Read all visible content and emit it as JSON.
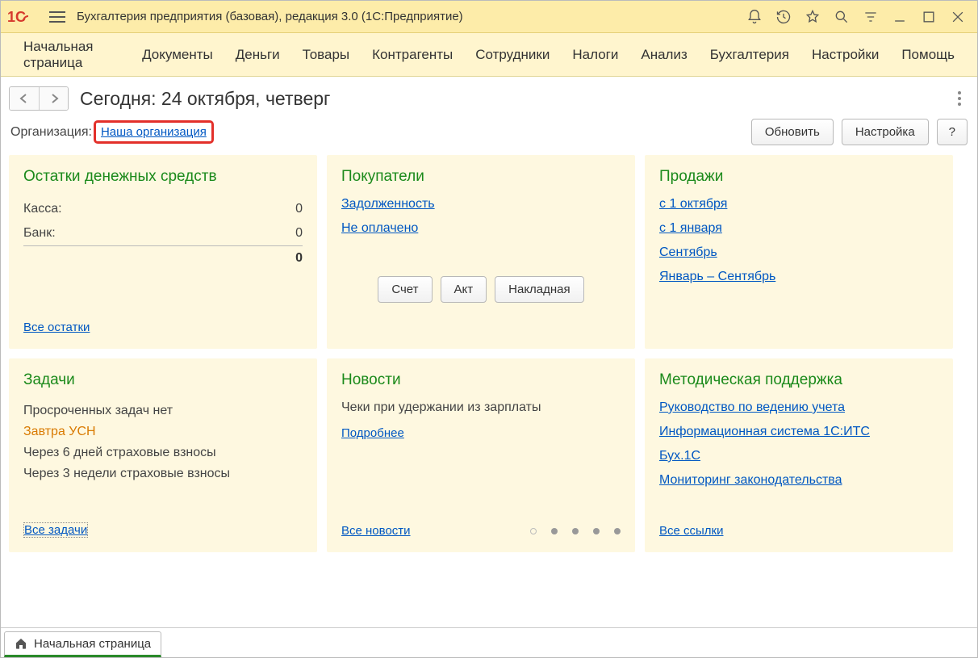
{
  "titlebar": {
    "title": "Бухгалтерия предприятия (базовая), редакция 3.0  (1С:Предприятие)"
  },
  "menu": {
    "items": [
      "Начальная страница",
      "Документы",
      "Деньги",
      "Товары",
      "Контрагенты",
      "Сотрудники",
      "Налоги",
      "Анализ",
      "Бухгалтерия",
      "Настройки",
      "Помощь"
    ]
  },
  "page": {
    "title": "Сегодня: 24 октября, четверг",
    "org_label": "Организация:",
    "org_link": "Наша организация",
    "refresh_btn": "Обновить",
    "settings_btn": "Настройка",
    "help_btn": "?"
  },
  "widgets": {
    "cash": {
      "title": "Остатки денежных средств",
      "rows": [
        {
          "label": "Касса:",
          "value": "0"
        },
        {
          "label": "Банк:",
          "value": "0"
        }
      ],
      "total": "0",
      "footer_link": "Все остатки"
    },
    "buyers": {
      "title": "Покупатели",
      "links": [
        "Задолженность",
        "Не оплачено"
      ],
      "buttons": [
        "Счет",
        "Акт",
        "Накладная"
      ]
    },
    "sales": {
      "title": "Продажи",
      "links": [
        "с 1 октября",
        "с 1 января",
        "Сентябрь",
        "Январь – Сентябрь"
      ]
    },
    "tasks": {
      "title": "Задачи",
      "items": [
        {
          "text": "Просроченных задач нет",
          "style": "normal"
        },
        {
          "text": "Завтра УСН",
          "style": "orange"
        },
        {
          "text": "Через 6 дней страховые взносы",
          "style": "normal"
        },
        {
          "text": "Через 3 недели страховые взносы",
          "style": "normal"
        }
      ],
      "footer_link": "Все задачи"
    },
    "news": {
      "title": "Новости",
      "headline": "Чеки при удержании из зарплаты",
      "more_link": "Подробнее",
      "footer_link": "Все новости",
      "page_count": 5,
      "active_page": 1
    },
    "support": {
      "title": "Методическая поддержка",
      "links": [
        "Руководство по ведению учета",
        "Информационная система 1С:ИТС",
        "Бух.1С",
        "Мониторинг законодательства"
      ],
      "footer_link": "Все ссылки"
    }
  },
  "tabs": {
    "items": [
      "Начальная страница"
    ]
  }
}
